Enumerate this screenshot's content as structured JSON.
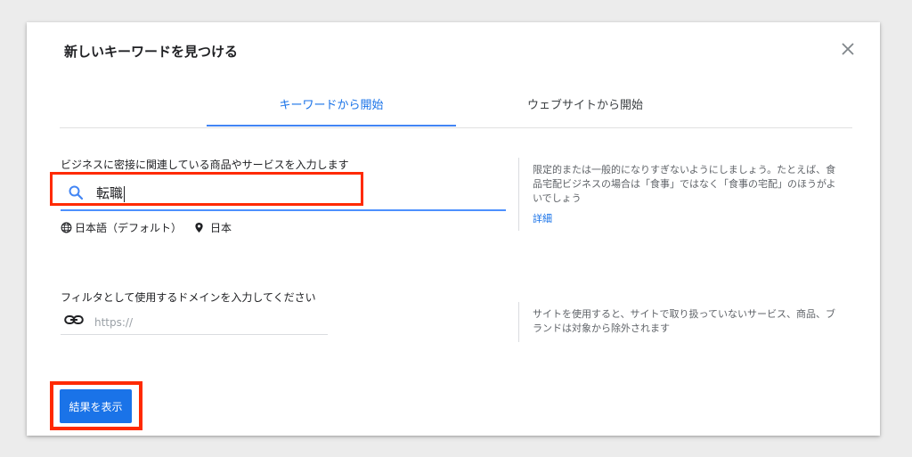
{
  "dialog": {
    "title": "新しいキーワードを見つける",
    "close_icon": "close-icon"
  },
  "tabs": [
    {
      "label": "キーワードから開始",
      "active": true
    },
    {
      "label": "ウェブサイトから開始",
      "active": false
    }
  ],
  "keyword_section": {
    "label": "ビジネスに密接に関連している商品やサービスを入力します",
    "search_value": "転職",
    "language": "日本語（デフォルト）",
    "location": "日本",
    "tip": "限定的または一般的になりすぎないようにしましょう。たとえば、食品宅配ビジネスの場合は「食事」ではなく「食事の宅配」のほうがよいでしょう",
    "tip_link": "詳細"
  },
  "domain_section": {
    "label": "フィルタとして使用するドメインを入力してください",
    "placeholder": "https://",
    "tip": "サイトを使用すると、サイトで取り扱っていないサービス、商品、ブランドは対象から除外されます"
  },
  "actions": {
    "show_results_label": "結果を表示"
  },
  "colors": {
    "accent": "#1a73e8",
    "highlight": "#ff2a00"
  }
}
